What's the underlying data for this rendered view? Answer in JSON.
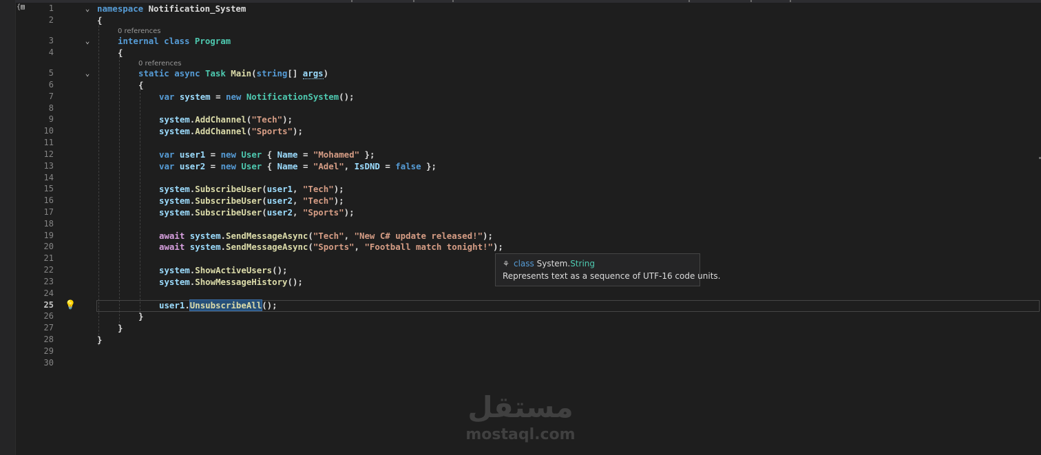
{
  "editor": {
    "references_label": "0 references",
    "active_line": "25",
    "line_numbers": [
      "1",
      "2",
      "3",
      "4",
      "5",
      "6",
      "7",
      "8",
      "9",
      "10",
      "11",
      "12",
      "13",
      "14",
      "15",
      "16",
      "17",
      "18",
      "19",
      "20",
      "21",
      "22",
      "23",
      "24",
      "25",
      "26",
      "27",
      "28",
      "29",
      "30"
    ],
    "code": {
      "l1_kw": "namespace",
      "l1_ns": " Notification_System",
      "brace_open": "{",
      "brace_close": "}",
      "l3_kw1": "internal",
      "l3_kw2": " class",
      "l3_ty": " Program",
      "l5_kw1": "static",
      "l5_kw2": " async",
      "l5_ty": " Task",
      "l5_mt": " Main",
      "l5_p1": "(",
      "l5_kw3": "string",
      "l5_p2": "[] ",
      "l5_id": "args",
      "l5_p3": ")",
      "var": "var",
      "new": "new",
      "await": "await",
      "system": "system",
      "dot": ".",
      "l7_id": " system",
      "l7_p1": " = ",
      "l7_ty": " NotificationSystem",
      "l7_p2": "();",
      "add_channel": "AddChannel",
      "subscribe_user": "SubscribeUser",
      "send_message": "SendMessageAsync",
      "show_active": "ShowActiveUsers",
      "show_history": "ShowMessageHistory",
      "unsubscribe_all": "UnsubscribeAll",
      "str_tech": "\"Tech\"",
      "str_sports": "\"Sports\"",
      "str_mohamed": "\"Mohamed\"",
      "str_adel": "\"Adel\"",
      "str_update": "\"New C# update released!\"",
      "str_football": "\"Football match tonight!\"",
      "user1": "user1",
      "user2": "user2",
      "user_ty": " User",
      "name_prop": "Name",
      "isdnd_prop": "IsDND",
      "false_kw": "false",
      "p_open": "(",
      "p_close_semi": ");",
      "p_empty_semi": "();",
      "comma": ", ",
      "eq": " = ",
      "brace_obj_open": " { ",
      "brace_obj_close": " };"
    }
  },
  "tooltip": {
    "icon": "class-icon",
    "keyword": "class",
    "namespace": " System.",
    "type": "String",
    "description": "Represents text as a sequence of UTF-16 code units."
  },
  "watermark": {
    "arabic": "مستقل",
    "latin": "mostaql.com"
  },
  "colors": {
    "background": "#1e1e1e",
    "keyword": "#569cd6",
    "type": "#4ec9b0",
    "method": "#dcdcaa",
    "string": "#d69d85",
    "identifier": "#9cdcfe",
    "control": "#d8a0df"
  }
}
